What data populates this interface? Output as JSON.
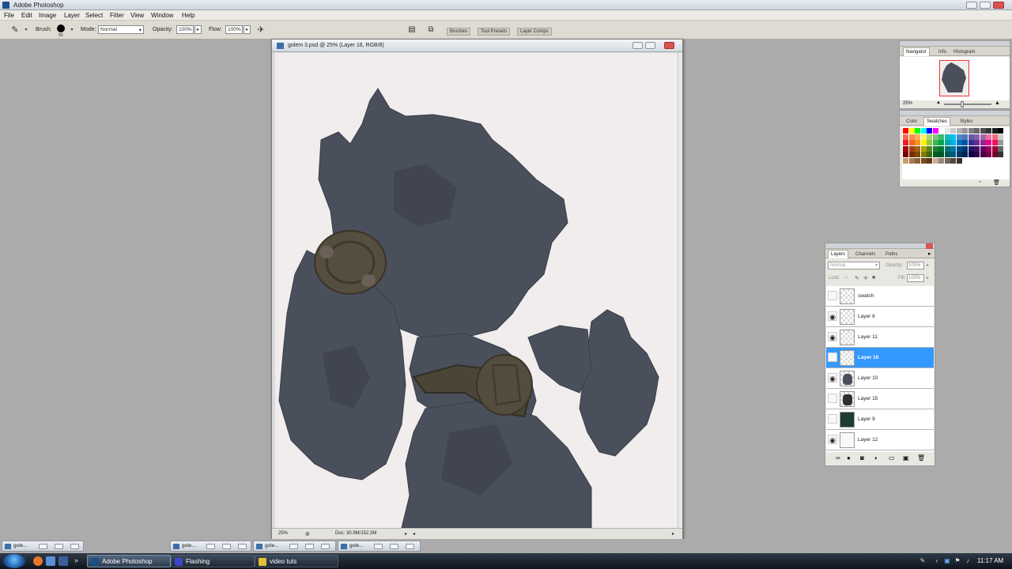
{
  "app": {
    "title": "Adobe Photoshop",
    "menu": [
      "File",
      "Edit",
      "Image",
      "Layer",
      "Select",
      "Filter",
      "View",
      "Window",
      "Help"
    ]
  },
  "options_bar": {
    "brush_label": "Brush:",
    "brush_size": "50",
    "mode_label": "Mode:",
    "mode_value": "Normal",
    "opacity_label": "Opacity:",
    "opacity_value": "100%",
    "flow_label": "Flow:",
    "flow_value": "100%",
    "palette_tabs": [
      "Brushes",
      "Tool Presets",
      "Layer Comps"
    ]
  },
  "document": {
    "title": "golem 3.psd @ 25% (Layer 16, RGB/8)",
    "zoom": "25%",
    "doc_info": "Doc: 30.9M/152.3M"
  },
  "navigator_panel": {
    "tabs": [
      "Navigator",
      "Info",
      "Histogram"
    ],
    "zoom": "25%"
  },
  "swatches_panel": {
    "tabs": [
      "Color",
      "Swatches",
      "Styles"
    ],
    "swatch_colors": [
      "#ff0000",
      "#ffff00",
      "#00ff00",
      "#00ffff",
      "#0000ff",
      "#ff00ff",
      "#ffffff",
      "#e6e6e6",
      "#cccccc",
      "#b3b3b3",
      "#999999",
      "#808080",
      "#666666",
      "#4d4d4d",
      "#333333",
      "#1a1a1a",
      "#000000",
      "#f26c4f",
      "#f68e55",
      "#fbaf5c",
      "#fff467",
      "#acd372",
      "#7cc576",
      "#3bb878",
      "#1abbb4",
      "#00bff3",
      "#438ccb",
      "#5574b9",
      "#605ca8",
      "#855fa8",
      "#a763a9",
      "#ef6ea8",
      "#f16d7e",
      "#cccccc",
      "#ed1c24",
      "#f26522",
      "#f7941d",
      "#fff200",
      "#8dc63f",
      "#39b54a",
      "#00a651",
      "#00a99d",
      "#00aeef",
      "#0072bc",
      "#0054a6",
      "#2e3192",
      "#662d91",
      "#92278f",
      "#ec008c",
      "#ed145b",
      "#999999",
      "#9e0b0f",
      "#a0410d",
      "#a36209",
      "#aba000",
      "#598527",
      "#1a7b30",
      "#007236",
      "#00746b",
      "#0076a3",
      "#004a80",
      "#003471",
      "#1b1464",
      "#440e62",
      "#630460",
      "#9e005d",
      "#9e0039",
      "#666666",
      "#790000",
      "#7b2e00",
      "#7d4900",
      "#827b00",
      "#406618",
      "#005e20",
      "#005826",
      "#005952",
      "#005b7f",
      "#003663",
      "#002157",
      "#0d004c",
      "#32004b",
      "#4b0049",
      "#7b0046",
      "#7a0026",
      "#333333",
      "#c69c6d",
      "#a67c52",
      "#8c6239",
      "#754c24",
      "#603913",
      "#c7b299",
      "#998675",
      "#736357",
      "#534741",
      "#362f2d",
      "#ffffff",
      "#ffffff",
      "#ffffff",
      "#ffffff",
      "#ffffff",
      "#ffffff",
      "#ffffff"
    ]
  },
  "layers_panel": {
    "tabs": [
      "Layers",
      "Channels",
      "Paths"
    ],
    "blend_mode": "Normal",
    "opacity_label": "Opacity:",
    "opacity_value": "100%",
    "lock_label": "Lock:",
    "fill_label": "Fill:",
    "fill_value": "100%",
    "layers": [
      {
        "name": "swatch",
        "visible": false,
        "selected": false,
        "thumb": "transparent"
      },
      {
        "name": "Layer 6",
        "visible": true,
        "selected": false,
        "thumb": "transparent"
      },
      {
        "name": "Layer 11",
        "visible": true,
        "selected": false,
        "thumb": "transparent"
      },
      {
        "name": "Layer 16",
        "visible": false,
        "selected": true,
        "thumb": "transparent"
      },
      {
        "name": "Layer 10",
        "visible": true,
        "selected": false,
        "thumb": "golem"
      },
      {
        "name": "Layer 15",
        "visible": false,
        "selected": false,
        "thumb": "dark2"
      },
      {
        "name": "Layer 9",
        "visible": false,
        "selected": false,
        "thumb": "dark"
      },
      {
        "name": "Layer 12",
        "visible": true,
        "selected": false,
        "thumb": "transparent"
      }
    ]
  },
  "minimized_windows": [
    {
      "label": "gole..."
    },
    {
      "label": "gole..."
    },
    {
      "label": "gole..."
    },
    {
      "label": "gole..."
    }
  ],
  "taskbar": {
    "tasks": [
      {
        "label": "Adobe Photoshop",
        "active": true,
        "color": "#1b4f8a"
      },
      {
        "label": "Flashing",
        "active": false,
        "color": "#3a46c6"
      },
      {
        "label": "video tuts",
        "active": false,
        "color": "#e3c03b"
      }
    ],
    "clock": "11:17 AM"
  }
}
